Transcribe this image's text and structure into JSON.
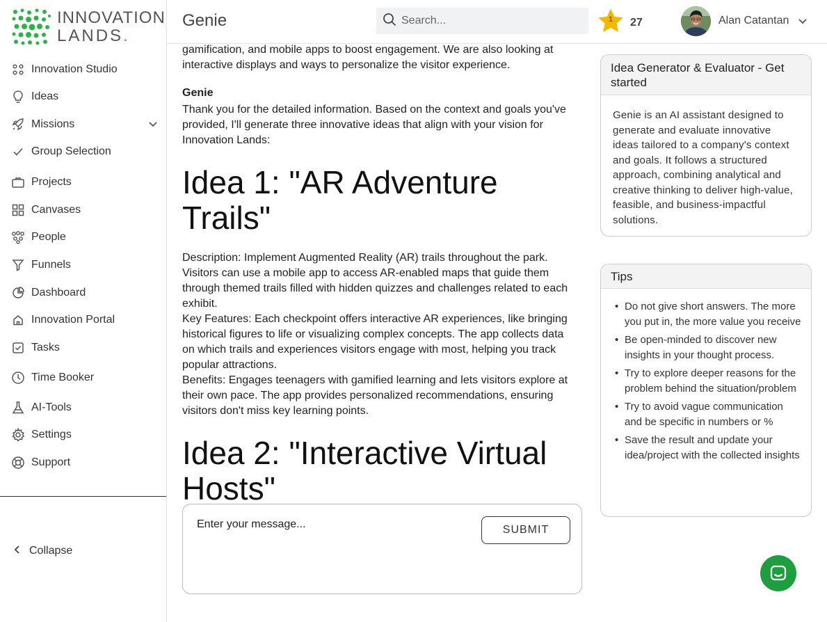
{
  "brand": {
    "name_line1": "INNOVATION",
    "name_line2": "LANDS",
    "name_dot": ".",
    "color": "#2db34a"
  },
  "sidebar": {
    "items": [
      {
        "label": "Innovation Studio",
        "icon": "dots-grid-icon"
      },
      {
        "label": "Ideas",
        "icon": "lightbulb-icon"
      },
      {
        "label": "Missions",
        "icon": "rocket-icon",
        "expandable": true
      },
      {
        "label": "Group Selection",
        "icon": "check-icon"
      },
      {
        "label": "Projects",
        "icon": "briefcase-icon"
      },
      {
        "label": "Canvases",
        "icon": "grid-icon"
      },
      {
        "label": "People",
        "icon": "people-icon"
      },
      {
        "label": "Funnels",
        "icon": "funnel-icon"
      },
      {
        "label": "Dashboard",
        "icon": "pie-chart-icon"
      },
      {
        "label": "Innovation Portal",
        "icon": "home-icon"
      },
      {
        "label": "Tasks",
        "icon": "checkbox-icon"
      },
      {
        "label": "Time Booker",
        "icon": "clock-icon"
      },
      {
        "label": "AI-Tools",
        "icon": "flask-icon"
      },
      {
        "label": "Settings",
        "icon": "gear-icon"
      },
      {
        "label": "Support",
        "icon": "lifebuoy-icon"
      }
    ],
    "collapse_label": "Collapse"
  },
  "header": {
    "title": "Genie",
    "search_placeholder": "Search...",
    "level": "1",
    "points": "27",
    "user_name": "Alan Catantan"
  },
  "chat": {
    "partial_prev": "gamification, and mobile apps to boost engagement. We are also looking at interactive displays and ways to personalize the visitor experience.",
    "speaker": "Genie",
    "intro": "Thank you for the detailed information. Based on the context and goals you've provided, I'll generate three innovative ideas that align with your vision for Innovation Lands:",
    "idea1_title": "Idea 1: \"AR Adventure Trails\"",
    "idea1_description": "Description: Implement Augmented Reality (AR) trails throughout the park. Visitors can use a mobile app to access AR-enabled maps that guide them through themed trails filled with hidden quizzes and challenges related to each exhibit.",
    "idea1_features": "Key Features: Each checkpoint offers interactive AR experiences, like bringing historical figures to life or visualizing complex concepts. The app collects data on which trails and experiences visitors engage with most, helping you track popular attractions.",
    "idea1_benefits": "Benefits: Engages teenagers with gamified learning and lets visitors explore at their own pace. The app provides personalized recommendations, ensuring visitors don't miss key learning points.",
    "idea2_title": "Idea 2: \"Interactive Virtual Hosts\""
  },
  "composer": {
    "placeholder": "Enter your message...",
    "submit_label": "SUBMIT"
  },
  "info_card": {
    "title": "Idea Generator & Evaluator - Get started",
    "body": "Genie is an AI assistant designed to generate and evaluate innovative ideas tailored to a company's context and goals. It follows a structured approach, combining analytical and creative thinking to deliver high-value, feasible, and business-impactful solutions."
  },
  "tips_card": {
    "title": "Tips",
    "items": [
      "Do not give short answers. The more you put in, the more value you receive",
      "Be open-minded to discover new insights in your thought process.",
      "Try to explore deeper reasons for the problem behind the situation/problem",
      "Try to avoid vague communication and be specific in numbers or %",
      "Save the result and update your idea/project with the collected insights"
    ]
  },
  "colors": {
    "accent_green": "#1f9e3f",
    "star_yellow": "#f5b800"
  }
}
